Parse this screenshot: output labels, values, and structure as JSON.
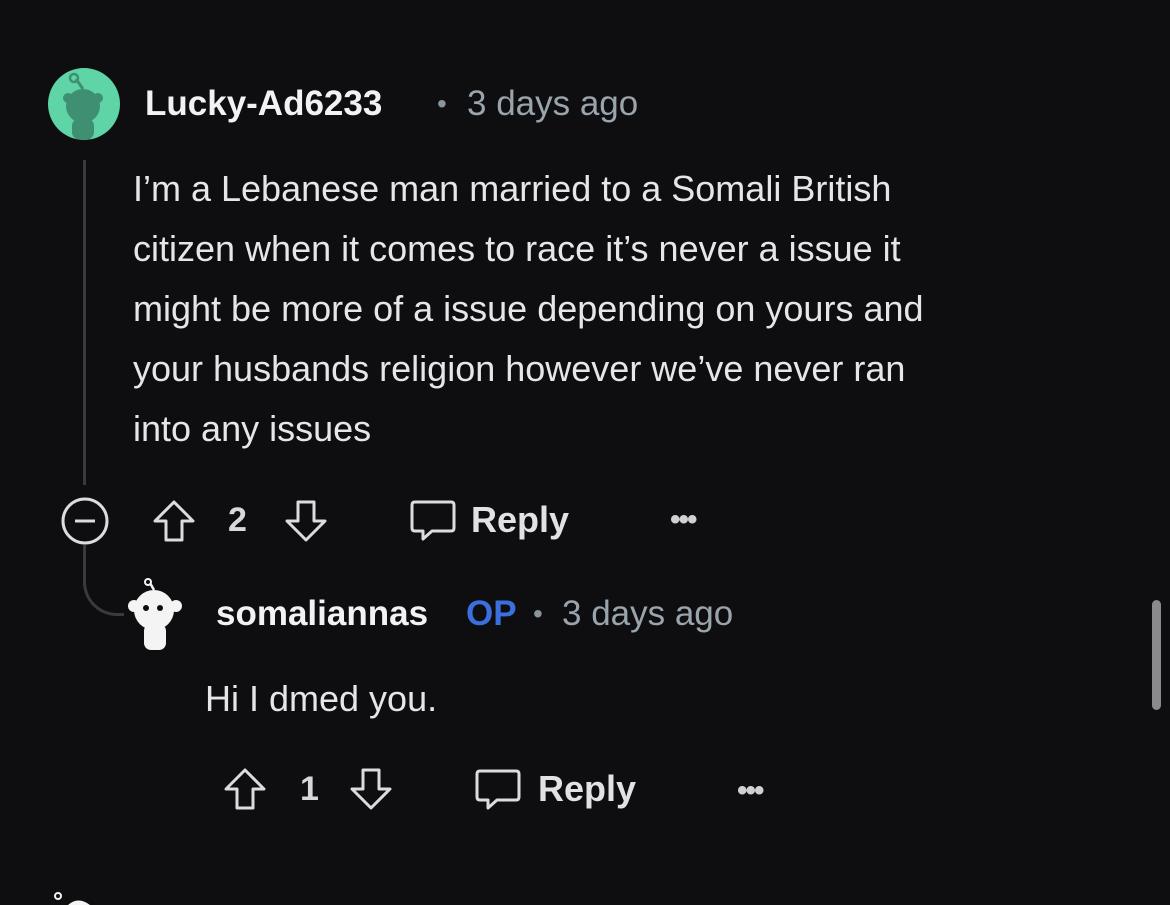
{
  "colors": {
    "background": "#0e0e10",
    "op_badge": "#3b6fe0",
    "avatar_bg": "#5ed4a7"
  },
  "comment1": {
    "username": "Lucky-Ad6233",
    "separator": "•",
    "time": "3 days ago",
    "body_lines": [
      "I’m a Lebanese man married to a Somali British",
      "citizen when it comes to race it’s never a issue it",
      "might be more of a issue depending on yours and",
      "your husbands religion however we’ve never ran",
      "into any issues"
    ],
    "actions": {
      "collapse_icon": "minus-circle-icon",
      "upvote_icon": "arrow-up-icon",
      "vote_count": "2",
      "downvote_icon": "arrow-down-icon",
      "reply_icon": "chat-bubble-icon",
      "reply_label": "Reply",
      "more_label": "•••"
    }
  },
  "comment2": {
    "username": "somaliannas",
    "op_badge": "OP",
    "separator": "•",
    "time": "3 days ago",
    "body": "Hi I dmed you.",
    "actions": {
      "upvote_icon": "arrow-up-icon",
      "vote_count": "1",
      "downvote_icon": "arrow-down-icon",
      "reply_icon": "chat-bubble-icon",
      "reply_label": "Reply",
      "more_label": "•••"
    }
  }
}
